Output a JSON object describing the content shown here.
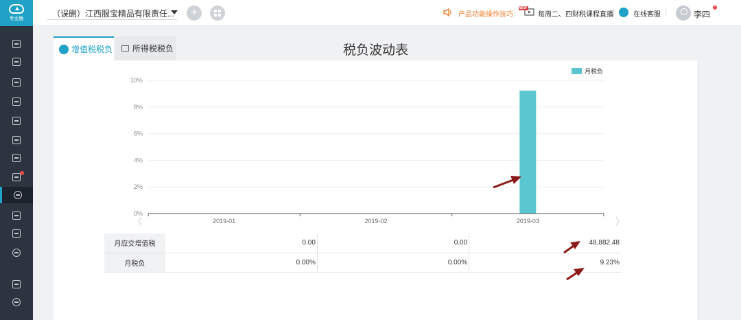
{
  "sidebar": {
    "logo_text": "专业版",
    "items": [
      "report-icon",
      "voucher-icon",
      "chart-icon",
      "ledger-icon",
      "calendar-icon",
      "book-icon",
      "invoice-icon",
      "tax-report-icon",
      "tax-burden-icon",
      "search-doc-icon",
      "shield-icon",
      "settings-icon",
      "video-icon",
      "speed-icon"
    ]
  },
  "header": {
    "company": "（误删）江西服宝精品有限责任...",
    "tips": "产品功能操作技巧",
    "new_badge": "NEW",
    "live": "每周二、四财税课程直播",
    "support": "在线客服",
    "user": "李四"
  },
  "tabs": [
    {
      "label": "增值税税负"
    },
    {
      "label": "所得税税负"
    }
  ],
  "page_title": "税负波动表",
  "chart_data": {
    "type": "bar",
    "categories": [
      "2019-01",
      "2019-02",
      "2019-03"
    ],
    "series": [
      {
        "name": "月税负",
        "values": [
          0.0,
          0.0,
          9.23
        ],
        "color": "#5bc6cf"
      }
    ],
    "ylim": [
      0,
      10
    ],
    "yticks": [
      "0%",
      "2%",
      "4%",
      "6%",
      "8%",
      "10%"
    ],
    "legend_position": "top-right",
    "grid": true
  },
  "table": {
    "rows": [
      {
        "label": "月应交增值税",
        "values": [
          "0.00",
          "0.00",
          "48,882.48"
        ]
      },
      {
        "label": "月税负",
        "values": [
          "0.00%",
          "0.00%",
          "9.23%"
        ]
      }
    ]
  },
  "colors": {
    "accent": "#1fa2c6",
    "bar": "#5bc6cf",
    "arrow": "#8b1a1a",
    "tips": "#f07c2a"
  }
}
